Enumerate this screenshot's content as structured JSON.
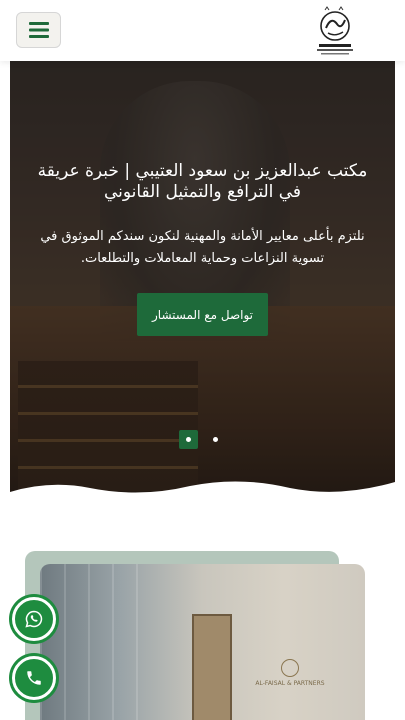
{
  "header": {
    "menu_icon": "hamburger-icon",
    "logo_alt": "شعار مكتب عبدالعزيز بن سعود العتيبي"
  },
  "hero": {
    "title": "مكتب عبدالعزيز بن سعود العتيبي | خبرة عريقة في الترافع والتمثيل القانوني",
    "subtitle": "نلتزم بأعلى معايير الأمانة والمهنية لنكون سندكم الموثوق في تسوية النزاعات وحماية المعاملات والتطلعات.",
    "cta_label": "تواصل مع المستشار",
    "slides": [
      {
        "active": true
      },
      {
        "active": false
      }
    ]
  },
  "about": {
    "sign_text": "AL-FAISAL & PARTNERS"
  },
  "floating": {
    "whatsapp_icon": "whatsapp-icon",
    "phone_icon": "phone-icon"
  },
  "colors": {
    "brand_green": "#1e6a3a",
    "float_green": "#1e8c3f",
    "about_bg": "#b4c6bb"
  }
}
